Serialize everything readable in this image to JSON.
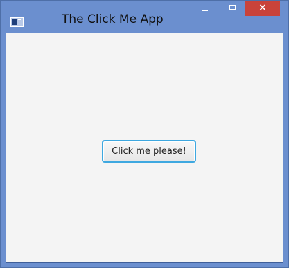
{
  "window": {
    "title": "The Click Me App",
    "controls": {
      "minimize_icon": "minimize-icon",
      "maximize_icon": "maximize-icon",
      "close_icon": "close-icon",
      "close_glyph": "×"
    }
  },
  "content": {
    "button_label": "Click me please!"
  },
  "colors": {
    "frame": "#6b8fcf",
    "close_button": "#c9433a",
    "client_background": "#f4f4f4",
    "button_focus_border": "#3ea8e0"
  }
}
